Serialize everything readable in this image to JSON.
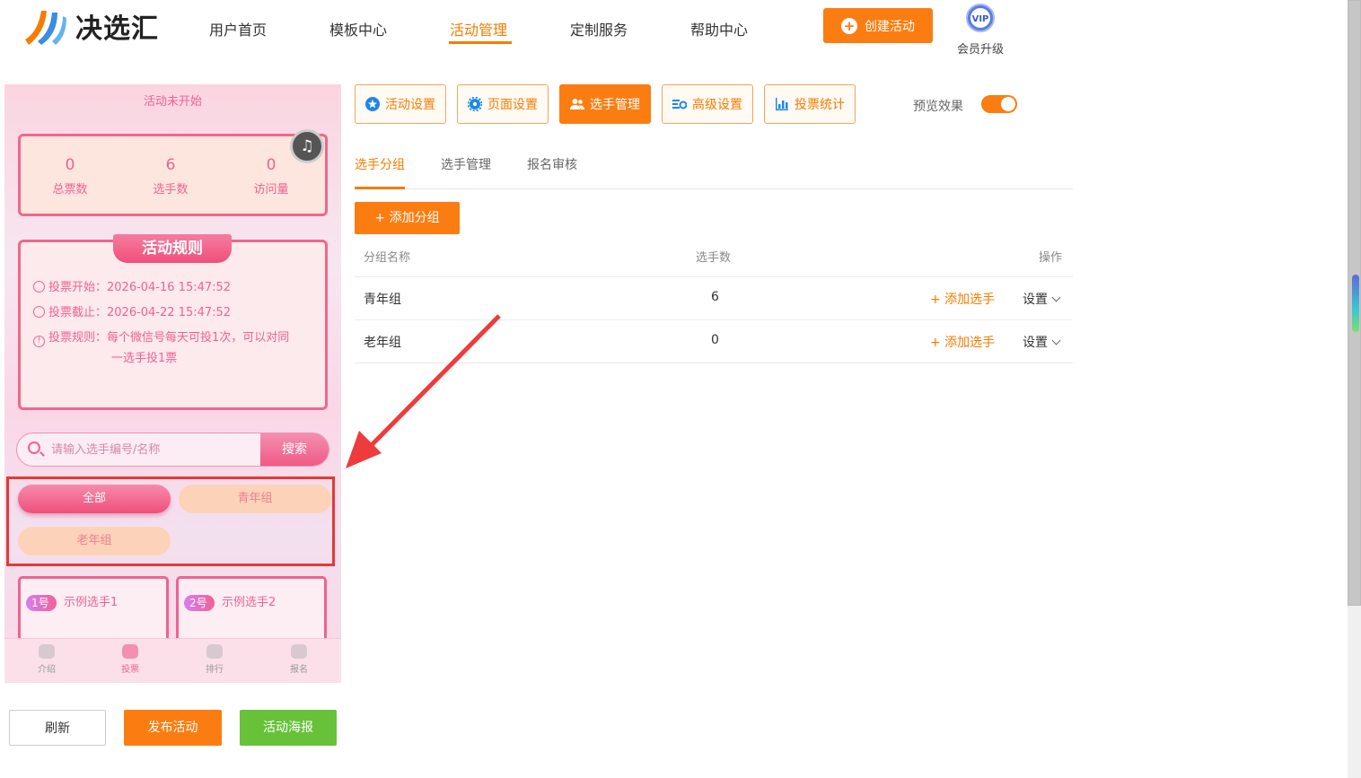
{
  "header": {
    "logo_text": "决选汇",
    "nav": [
      {
        "label": "用户首页"
      },
      {
        "label": "模板中心"
      },
      {
        "label": "活动管理"
      },
      {
        "label": "定制服务"
      },
      {
        "label": "帮助中心"
      }
    ],
    "create_button": "创建活动",
    "vip_badge": "VIP",
    "vip_label": "会员升级"
  },
  "preview": {
    "status": "活动未开始",
    "stats": [
      {
        "value": "0",
        "label": "总票数"
      },
      {
        "value": "6",
        "label": "选手数"
      },
      {
        "value": "0",
        "label": "访问量"
      }
    ],
    "rules_title": "活动规则",
    "rules": {
      "start": "投票开始：2026-04-16 15:47:52",
      "end": "投票截止：2026-04-22 15:47:52",
      "rule_line1": "投票规则：每个微信号每天可投1次，可以对同",
      "rule_line2": "一选手投1票"
    },
    "search_placeholder": "请输入选手编号/名称",
    "search_button": "搜索",
    "groups": [
      {
        "label": "全部"
      },
      {
        "label": "青年组"
      },
      {
        "label": "老年组"
      }
    ],
    "contestants": [
      {
        "badge": "1号",
        "name": "示例选手1"
      },
      {
        "badge": "2号",
        "name": "示例选手2"
      }
    ],
    "tabbar": [
      {
        "label": "介绍"
      },
      {
        "label": "投票"
      },
      {
        "label": "排行"
      },
      {
        "label": "报名"
      }
    ]
  },
  "actions": {
    "refresh": "刷新",
    "publish": "发布活动",
    "poster": "活动海报"
  },
  "panel": {
    "tabs": [
      {
        "label": "活动设置"
      },
      {
        "label": "页面设置"
      },
      {
        "label": "选手管理"
      },
      {
        "label": "高级设置"
      },
      {
        "label": "投票统计"
      }
    ],
    "preview_label": "预览效果",
    "subtabs": [
      {
        "label": "选手分组"
      },
      {
        "label": "选手管理"
      },
      {
        "label": "报名审核"
      }
    ],
    "add_group_button": "+ 添加分组",
    "table": {
      "headers": [
        "分组名称",
        "选手数",
        "操作"
      ],
      "rows": [
        {
          "name": "青年组",
          "count": "6",
          "add": "+ 添加选手",
          "settings": "设置"
        },
        {
          "name": "老年组",
          "count": "0",
          "add": "+ 添加选手",
          "settings": "设置"
        }
      ]
    }
  },
  "colors": {
    "accent": "#fb7d12",
    "pink": "#f06292",
    "green": "#67c23a",
    "highlight": "#e53935"
  }
}
